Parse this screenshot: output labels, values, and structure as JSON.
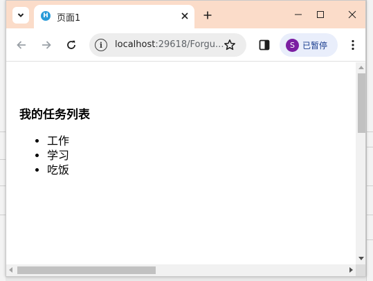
{
  "tab": {
    "title": "页面1",
    "favicon_letter": "H"
  },
  "address": {
    "host": "localhost",
    "rest": ":29618/Forgu..."
  },
  "profile": {
    "initial": "S",
    "label": "已暂停"
  },
  "page": {
    "heading": "我的任务列表",
    "items": [
      "工作",
      "学习",
      "吃饭"
    ]
  },
  "colors": {
    "tabstrip": "#fbdcc9",
    "favicon": "#2a9bd8",
    "avatar": "#7b1fa2",
    "profile_chip": "#e9eefb"
  },
  "icons": {
    "tab_search": "chevron-down-icon",
    "tab_close": "close-icon",
    "new_tab": "plus-icon",
    "minimize": "minimize-icon",
    "maximize": "maximize-icon",
    "window_close": "close-icon",
    "back": "arrow-left-icon",
    "forward": "arrow-right-icon",
    "reload": "reload-icon",
    "site_info": "info-icon",
    "bookmark": "star-icon",
    "side_panel": "side-panel-icon",
    "menu": "kebab-menu-icon"
  }
}
